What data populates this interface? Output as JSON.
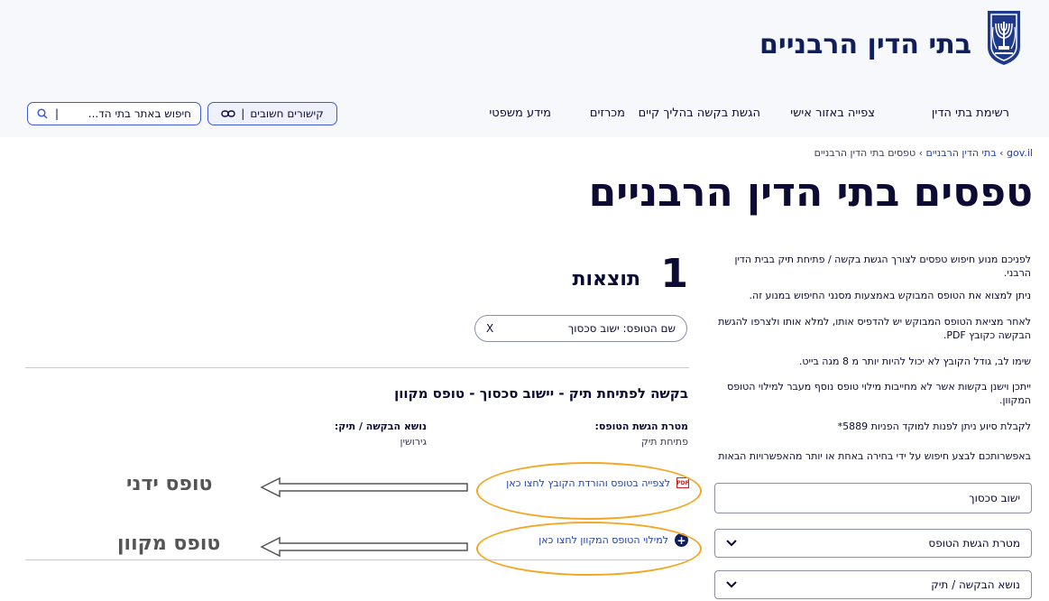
{
  "header": {
    "site_title": "בתי הדין הרבניים",
    "logo_text": "מדינת ישראל"
  },
  "nav": {
    "items": [
      "רשימת בתי הדין",
      "צפייה באזור אישי",
      "הגשת בקשה בהליך קיים",
      "מכרזים",
      "מידע משפטי"
    ],
    "links_button": "קישורים חשובים",
    "search_placeholder": "חיפוש באתר בתי הד..."
  },
  "breadcrumb": {
    "root": "gov.il",
    "parent": "בתי הדין הרבניים",
    "current": "טפסים בתי הדין הרבניים"
  },
  "page_title": "טפסים בתי הדין הרבניים",
  "info": {
    "p1": "לפניכם מנוע חיפוש טפסים לצורך הגשת בקשה / פתיחת תיק בבית הדין הרבני.",
    "p2": "ניתן למצוא את הטופס המבוקש באמצעות מסנני החיפוש במנוע זה.",
    "p3": "לאחר מציאת הטופס המבוקש יש להדפיס אותו, למלא אותו ולצרפו להגשת הבקשה כקובץ PDF.",
    "p4": "שימו לב, גודל הקובץ לא יכול להיות יותר מ 8 מגה בייט.",
    "p5": "ייתכן וישנן בקשות אשר לא מחייבות מילוי טופס נוסף מעבר למילוי הטופס המקוון.",
    "p6": "לקבלת סיוע ניתן לפנות למוקד הפניות 5889*",
    "p7": "באפשרותכם לבצע חיפוש על ידי בחירה באחת או יותר מהאפשרויות הבאות"
  },
  "filters": {
    "search_value": "ישוב סכסוך",
    "purpose_label": "מטרת הגשת הטופס",
    "subject_label": "נושא הבקשה / תיק"
  },
  "results": {
    "count": "1",
    "label": "תוצאות",
    "chip_label": "שם הטופס:",
    "chip_value": "ישוב סכסוך",
    "chip_close": "X"
  },
  "form": {
    "title": "בקשה לפתיחת תיק - יישוב סכסוך - טופס מקוון",
    "purpose_label": "מטרת הגשת הטופס:",
    "purpose_value": "פתיחת תיק",
    "subject_label": "נושא הבקשה / תיק:",
    "subject_value": "גירושין",
    "pdf_link": "לצפייה בטופס והורדת הקובץ לחצו כאן",
    "pdf_badge": "PDF",
    "online_link": "למילוי הטופס המקוון לחצו כאן"
  },
  "annotations": {
    "manual": "טופס ידני",
    "online": "טופס מקוון"
  },
  "colors": {
    "accent": "#3d5bd3",
    "highlight": "#f5a623",
    "navy": "#0f1f5c"
  }
}
